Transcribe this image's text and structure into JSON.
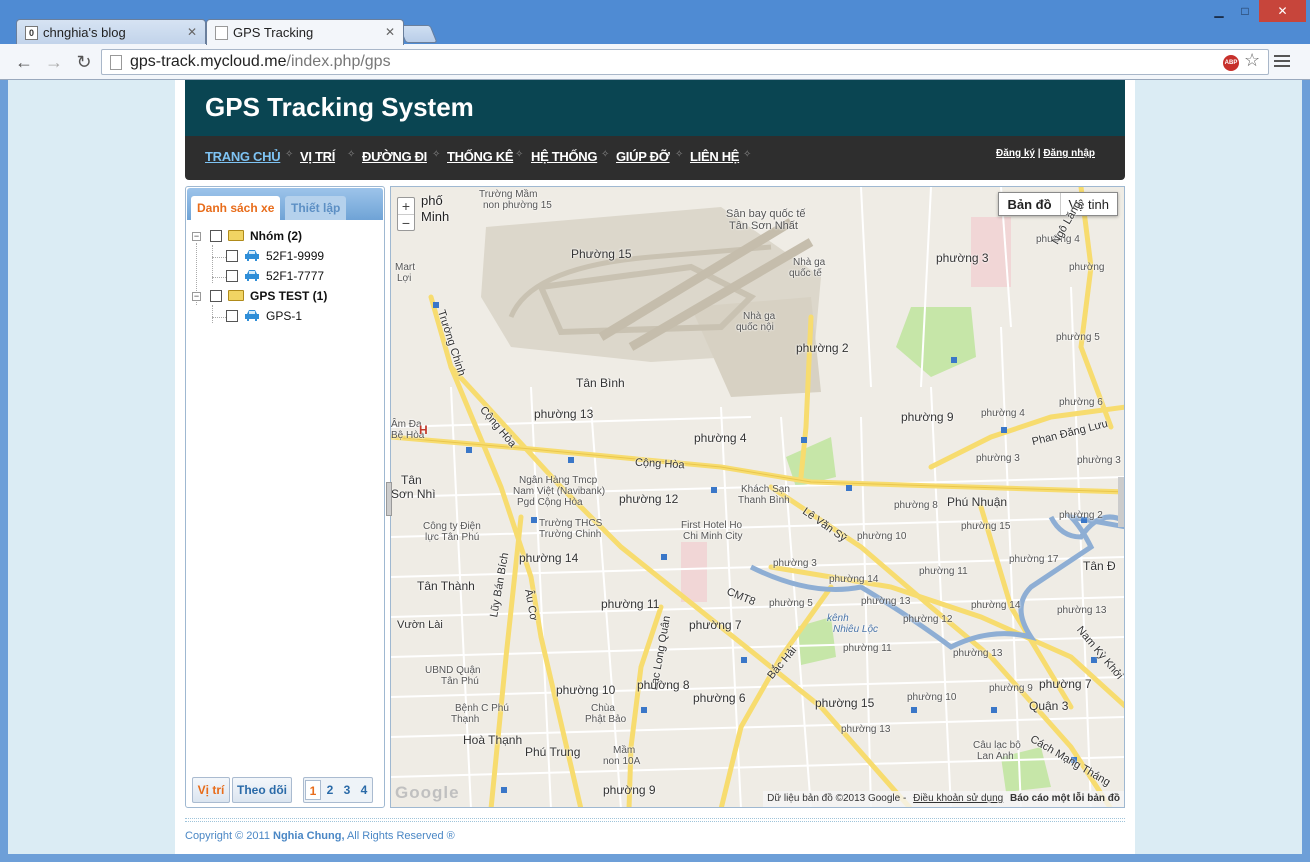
{
  "browser": {
    "tabs": [
      {
        "title": "chnghia's blog",
        "favicon": "blog-icon"
      },
      {
        "title": "GPS Tracking",
        "favicon": "page-icon"
      }
    ],
    "url_host": "gps-track.mycloud.me",
    "url_path": "/index.php/gps",
    "extension": "ABP"
  },
  "site": {
    "title": "GPS Tracking System",
    "nav": [
      "TRANG CHỦ",
      "VỊ TRÍ",
      "ĐƯỜNG ĐI",
      "THỐNG KÊ",
      "HỆ THỐNG",
      "GIÚP ĐỠ",
      "LIÊN HỆ"
    ],
    "register": "Đăng ký",
    "separator": "|",
    "login": "Đăng nhập"
  },
  "side": {
    "tabs": [
      "Danh sách xe",
      "Thiết lập"
    ],
    "tree": [
      {
        "group": "Nhóm (2)",
        "vehicles": [
          "52F1-9999",
          "52F1-7777"
        ]
      },
      {
        "group": "GPS TEST (1)",
        "vehicles": [
          "GPS-1"
        ]
      }
    ],
    "bottom_buttons": [
      "Vị trí",
      "Theo dõi"
    ],
    "pages": [
      "1",
      "2",
      "3",
      "4"
    ]
  },
  "map": {
    "zoom_in": "+",
    "zoom_out": "−",
    "types": [
      "Bản đồ",
      "Vệ tinh"
    ],
    "labels": {
      "thanhpho": "phố",
      "minh": "Minh",
      "truongmam": "Trường Mầm",
      "nonphuong15": "non phường 15",
      "sanbay1": "Sân bay quốc tế",
      "sanbay2": "Tân Sơn Nhất",
      "nhaga1": "Nhà ga",
      "nhaga2": "quốc tế",
      "nhaga3": "Nhà ga",
      "nhaga4": "quốc nội",
      "phuong15a": "Phường 15",
      "phuong2a": "phường 2",
      "tanbinh": "Tân Bình",
      "phuong13a": "phường 13",
      "phuong4a": "phường 4",
      "phuong12a": "phường 12",
      "conghoa": "Cộng Hòa",
      "conghoa2": "Cộng Hòa",
      "truongchinh": "Trường Chinh",
      "tanson": "Tân",
      "sonnhi": "Sơn Nhì",
      "nganhang1": "Ngân Hàng Tmcp",
      "nganhang2": "Nam Việt (Navibank)",
      "nganhang3": "Pgd Cộng Hòa",
      "khachsan1": "Khách Sạn",
      "khachsan2": "Thanh Bình",
      "congty1": "Công ty Điện",
      "congty2": "lực Tân Phú",
      "truongthcs1": "Trường THCS",
      "truongthcs2": "Trường Chinh",
      "firsthotel1": "First Hotel Ho",
      "firsthotel2": "Chi Minh City",
      "phuong14a": "phường 14",
      "tanthanh": "Tân Thành",
      "lybien": "Lũy Bán Bích",
      "auco": "Âu Cơ",
      "vuonlai": "Vườn Lài",
      "phuong11a": "phường 11",
      "phuong7a": "phường 7",
      "laclongquan": "Lạc Long Quân",
      "cmt8": "CMT8",
      "ubnd1": "UBND Quận",
      "ubnd2": "Tân Phú",
      "phuong10a": "phường 10",
      "phuong8a": "phường 8",
      "phuong6a": "phường 6",
      "bvcphu1": "Bệnh C Phú",
      "bvcphu2": "Thạnh",
      "chua1": "Chùa",
      "chua2": "Phật Bảo",
      "hoathanh": "Hoà Thạnh",
      "phutrung": "Phú Trung",
      "mam1": "Mầm",
      "mam2": "non 10A",
      "phuong9a": "phường 9",
      "lamdan1": "Âm Đa",
      "lamdan2": "Bệ Hòa",
      "mart1": "Mart",
      "mart2": "Lợi",
      "phuong3a": "phường 3",
      "phuong4b": "phường 4",
      "phuong5a": "phường 5",
      "phuong9b": "phường 9",
      "phuong4c": "phường 4",
      "phuong6b": "phường 6",
      "phuong3b": "phường 3",
      "phandangluu": "Phan Đăng Lưu",
      "phuong8b": "phường 8",
      "phunhuan": "Phú Nhuận",
      "phuong2b": "phường 2",
      "phuong15b": "phường 15",
      "levansy": "Lê Văn Sỹ",
      "phuong10b": "phường 10",
      "phuong3c": "phường 3",
      "phuong17": "phường 17",
      "tand": "Tân Đ",
      "phuong14b": "phường 14",
      "phuong11b": "phường 11",
      "phuong5b": "phường 5",
      "phuong13b": "phường 13",
      "phuong14c": "phường 14",
      "phuong13c": "phường 13",
      "phuong12b": "phường 12",
      "kenh1": "kênh",
      "kenh2": "Nhiêu Lộc",
      "phuong11c": "phường 11",
      "phuong13d": "phường 13",
      "bachai": "Bắc Hải",
      "phuong9c": "phường 9",
      "phuong7b": "phường 7",
      "namkykhoi": "Nam Kỳ Khởi",
      "phuong10c": "phường 10",
      "phuong15c": "phường 15",
      "quan3": "Quận 3",
      "phuong13e": "phường 13",
      "caulac1": "Câu lạc bộ",
      "caulac2": "Lan Anh",
      "cachmang": "Cách Mạng Tháng",
      "phuong1a": "phường",
      "nghilang": "Ngô Lăng",
      "phuong5c": "phường 5",
      "hospital_h": "H"
    },
    "attribution_data": "Dữ liệu bản đồ ©2013 Google -",
    "attribution_terms": "Điều khoản sử dụng",
    "attribution_report": "Báo cáo một lỗi bản đồ",
    "logo": "Google"
  },
  "footer": {
    "prefix": "Copyright © 2011",
    "author": "Nghia Chung,",
    "suffix": "All Rights Reserved ®"
  },
  "colors": {
    "header_bg": "#0a4552",
    "nav_bg": "#2e2e2e",
    "nav_active": "#7ec3f3",
    "accent_orange": "#e86c1a",
    "road_yellow": "#f7dc6f",
    "park_green": "#c6e6a8",
    "water": "#8eaed4"
  }
}
